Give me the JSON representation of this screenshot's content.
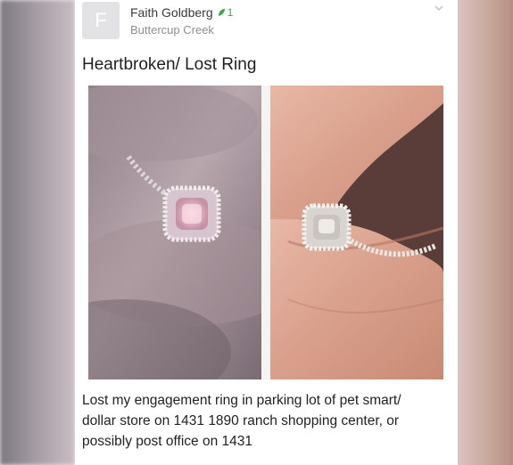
{
  "post": {
    "author": {
      "initial": "F",
      "name": "Faith Goldberg",
      "badge_count": "1",
      "location": "Buttercup Creek"
    },
    "title": "Heartbroken/ Lost Ring",
    "photos": [
      {
        "icon": "ring-photo-closeup"
      },
      {
        "icon": "ring-photo-on-hand"
      }
    ],
    "body": "Lost my engagement ring  in parking lot of pet smart/\ndollar store on 1431 1890 ranch shopping center, or\npossibly post office on 1431"
  },
  "colors": {
    "badge_green": "#3aa655",
    "avatar_bg": "#e3e3e6"
  }
}
